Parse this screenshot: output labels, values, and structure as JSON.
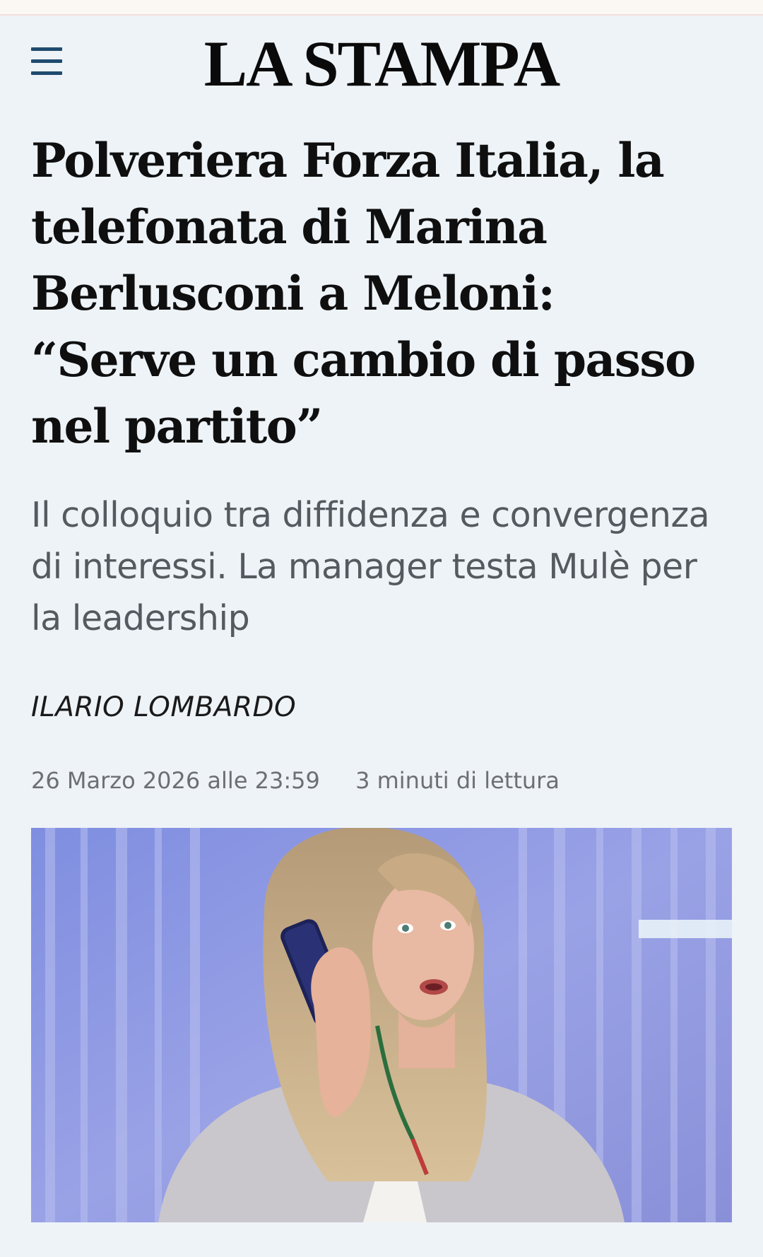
{
  "header": {
    "logo_text": "LA STAMPA",
    "menu_icon": "hamburger-menu-icon"
  },
  "article": {
    "headline": "Polveriera Forza Italia, la telefonata di Marina Berlusconi a Meloni: “Serve un cambio di passo nel partito”",
    "subtitle": "Il colloquio tra diffidenza e convergenza di interessi. La manager testa Mulè per la leadership",
    "author": "ILARIO LOMBARDO",
    "date": "26 Marzo 2026 alle 23:59",
    "reading_time": "3 minuti di lettura"
  },
  "colors": {
    "background": "#eef3f8",
    "accent": "#1f4b6e",
    "meta_text": "#6d6f72",
    "subtitle_text": "#555a60"
  }
}
